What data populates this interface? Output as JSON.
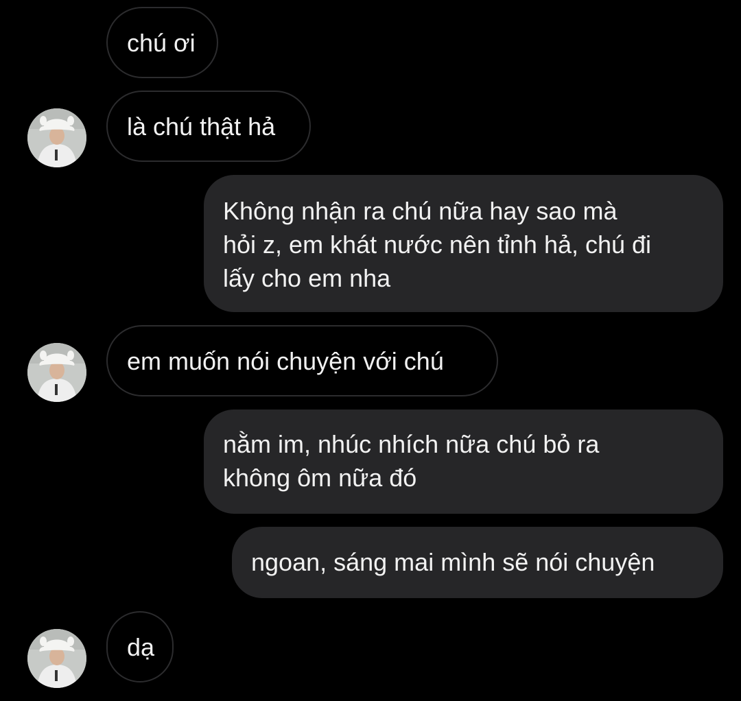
{
  "conversation": {
    "messages": [
      {
        "from": "contact",
        "text": "chú ơi"
      },
      {
        "from": "contact",
        "text": "là chú thật hả"
      },
      {
        "from": "me",
        "lines": [
          "Không nhận ra chú nữa hay sao mà",
          "hỏi z, em khát nước nên tỉnh hả, chú đi",
          "lấy cho em nha"
        ]
      },
      {
        "from": "contact",
        "text": "em muốn nói chuyện với chú"
      },
      {
        "from": "me",
        "lines": [
          "nằm im, nhúc nhích nữa chú bỏ ra",
          "không ôm nữa đó"
        ]
      },
      {
        "from": "me",
        "text": "ngoan, sáng mai mình sẽ nói chuyện"
      },
      {
        "from": "contact",
        "text": "dạ"
      }
    ]
  },
  "theme": {
    "background": "#000000",
    "incoming_border": "#2c2c2e",
    "outgoing_bubble": "#262628",
    "text": "#f2f2f2"
  }
}
